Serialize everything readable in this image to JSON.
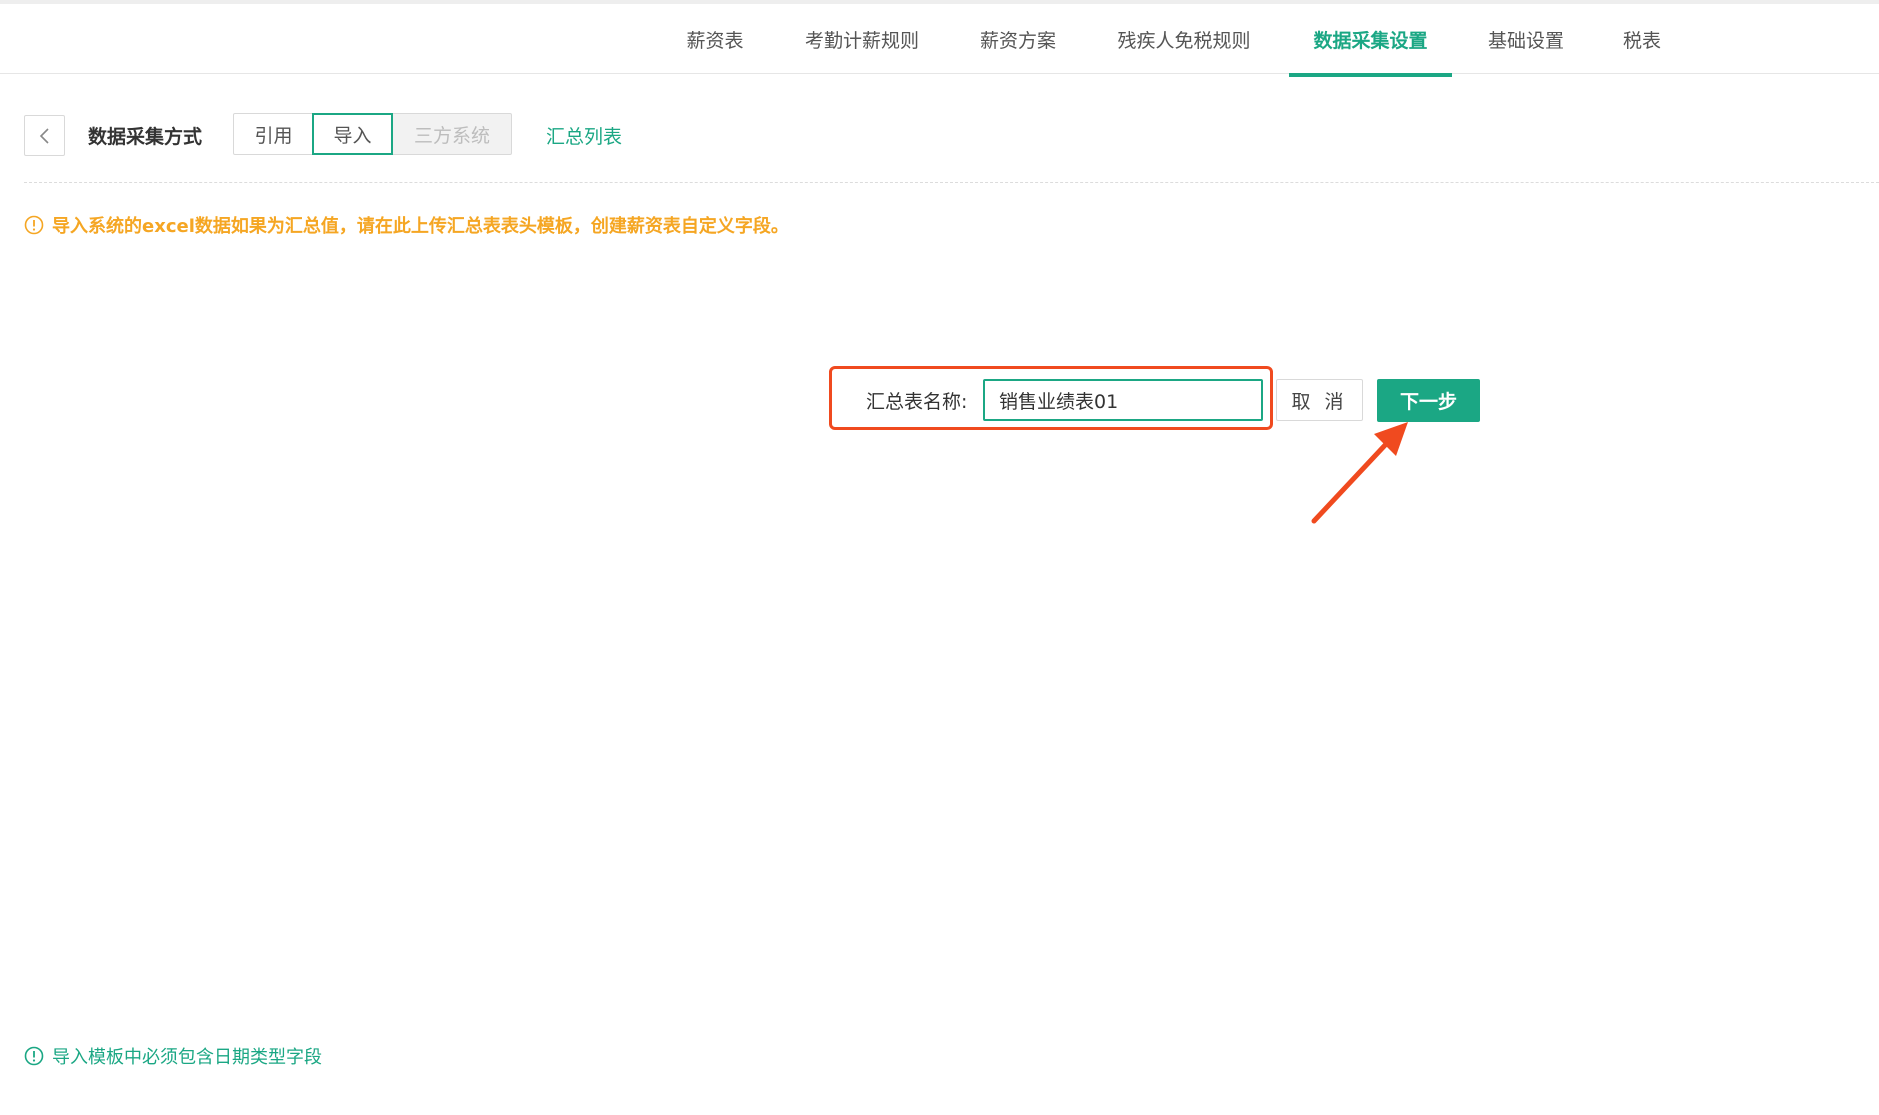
{
  "tabs": [
    {
      "label": "薪资表"
    },
    {
      "label": "考勤计薪规则"
    },
    {
      "label": "薪资方案"
    },
    {
      "label": "残疾人免税规则"
    },
    {
      "label": "数据采集设置"
    },
    {
      "label": "基础设置"
    },
    {
      "label": "税表"
    }
  ],
  "active_tab": "数据采集设置",
  "collection": {
    "label": "数据采集方式",
    "options": [
      {
        "label": "引用"
      },
      {
        "label": "导入"
      },
      {
        "label": "三方系统"
      }
    ],
    "selected": "导入",
    "summary_link": "汇总列表"
  },
  "notices": {
    "warning": "导入系统的excel数据如果为汇总值，请在此上传汇总表表头模板，创建薪资表自定义字段。",
    "info": "导入模板中必须包含日期类型字段"
  },
  "form": {
    "name_label": "汇总表名称:",
    "name_value": "销售业绩表01",
    "cancel_label": "取 消",
    "next_label": "下一步"
  },
  "colors": {
    "accent": "#1ba784",
    "warning": "#f5a623",
    "annotation": "#f04a1f"
  },
  "icons": [
    "chevron-left-icon",
    "info-circle-icon",
    "annotation-arrow-icon"
  ]
}
